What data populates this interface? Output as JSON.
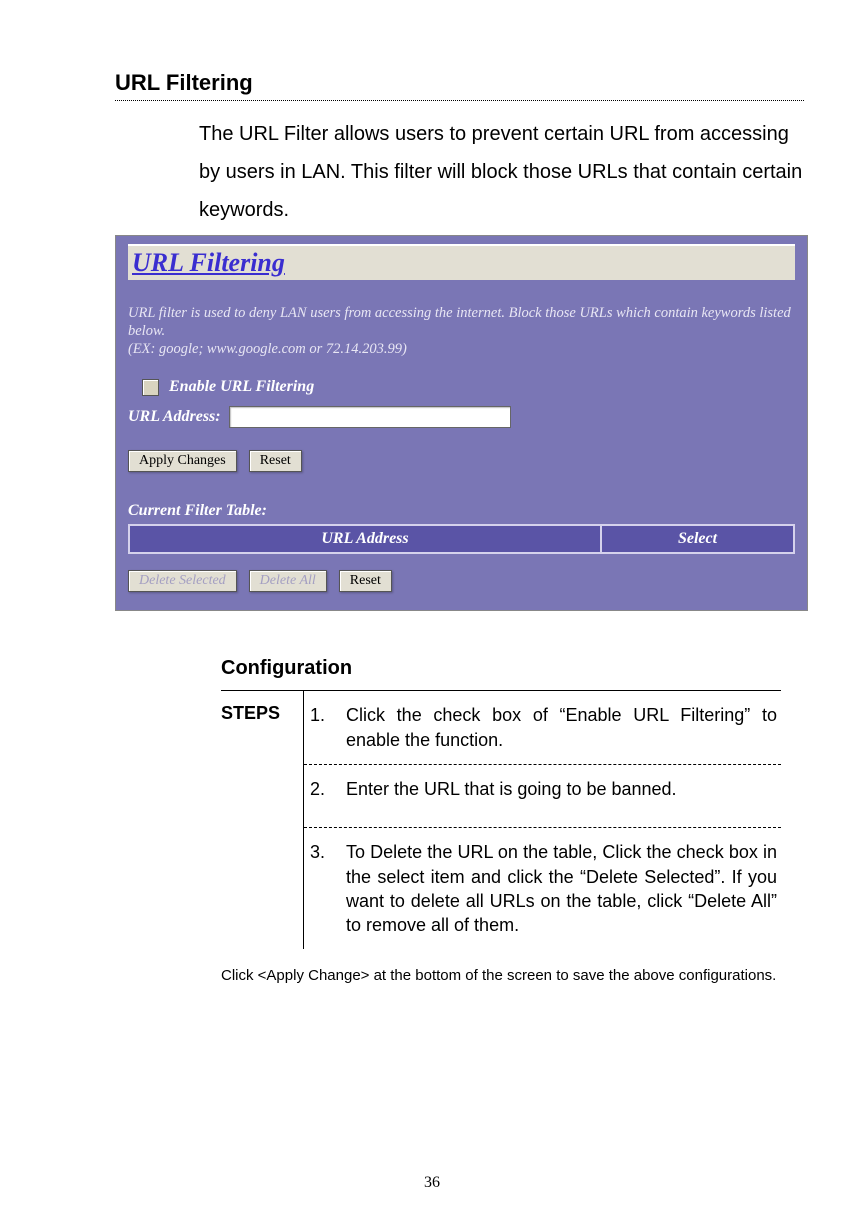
{
  "doc": {
    "section_title": "URL Filtering",
    "intro": "The URL Filter allows users to prevent certain URL from accessing by users in LAN. This filter will block those URLs that contain certain keywords.",
    "config_heading": "Configuration",
    "steps_label": "STEPS",
    "steps": [
      {
        "num": "1.",
        "text": "Click the check box of “Enable URL Filtering” to enable the function."
      },
      {
        "num": "2.",
        "text": "Enter the URL that is going to be banned."
      },
      {
        "num": "3.",
        "text": "To Delete the URL on the table, Click the check box in the select item and click the “Delete Selected”. If you want to delete all URLs on the table, click “Delete All” to remove all of them."
      }
    ],
    "footnote": "Click <Apply Change> at the bottom of the screen to save the above configurations.",
    "page_number": "36"
  },
  "screenshot": {
    "title": "URL Filtering",
    "description": "URL filter is used to deny LAN users from accessing the internet. Block those URLs which contain keywords listed below.",
    "example": "(EX: google; www.google.com or 72.14.203.99)",
    "enable_label": "Enable URL Filtering",
    "url_label": "URL Address:",
    "url_value": "",
    "buttons": {
      "apply": "Apply Changes",
      "reset1": "Reset",
      "delete_selected": "Delete Selected",
      "delete_all": "Delete All",
      "reset2": "Reset"
    },
    "table_title": "Current Filter Table:",
    "table_headers": {
      "address": "URL Address",
      "select": "Select"
    }
  }
}
